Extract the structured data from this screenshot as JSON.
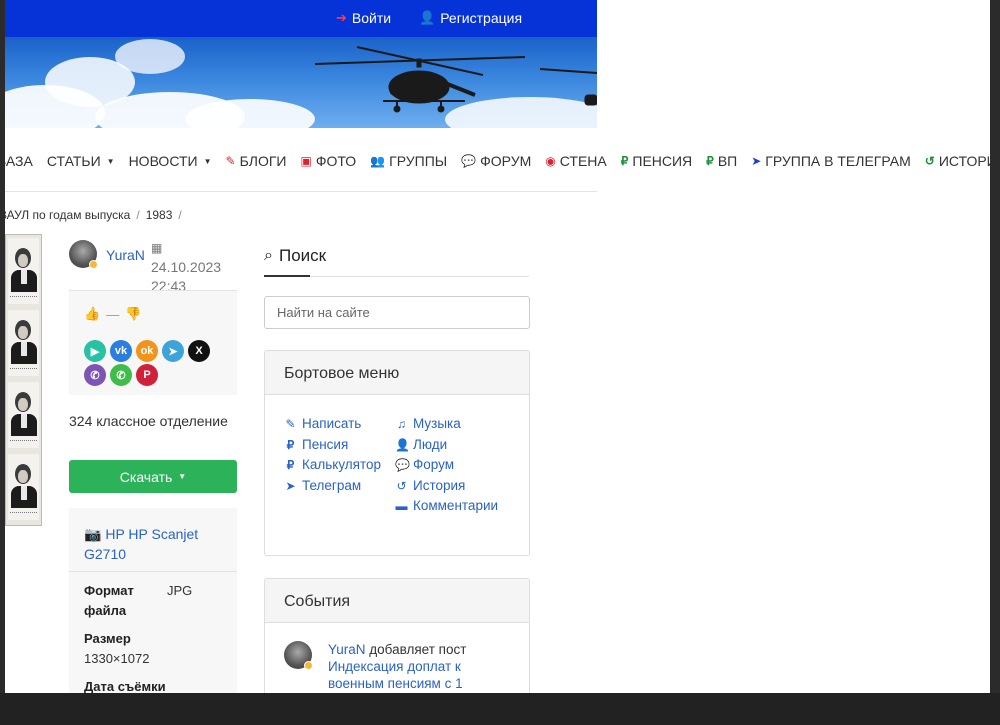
{
  "topbar": {
    "login": "Войти",
    "register": "Регистрация"
  },
  "nav": [
    {
      "label": "БАЗА",
      "icon": "",
      "caret": false,
      "color": "#333333"
    },
    {
      "label": "СТАТЬИ",
      "icon": "",
      "caret": true,
      "color": "#333333"
    },
    {
      "label": "НОВОСТИ",
      "icon": "",
      "caret": true,
      "color": "#333333"
    },
    {
      "label": "БЛОГИ",
      "icon": "pencil-icon",
      "caret": false,
      "color": "#e0202e"
    },
    {
      "label": "ФОТО",
      "icon": "images-icon",
      "caret": false,
      "color": "#e0202e"
    },
    {
      "label": "ГРУППЫ",
      "icon": "users-icon",
      "caret": false,
      "color": "#e0202e"
    },
    {
      "label": "ФОРУМ",
      "icon": "comments-icon",
      "caret": false,
      "color": "#e0202e"
    },
    {
      "label": "СТЕНА",
      "icon": "eye-icon",
      "caret": false,
      "color": "#e0202e"
    },
    {
      "label": "ПЕНСИЯ",
      "icon": "ruble-icon",
      "caret": false,
      "color": "#1f8f3a"
    },
    {
      "label": "ВП",
      "icon": "ruble-icon",
      "caret": false,
      "color": "#1f8f3a"
    },
    {
      "label": "ГРУППА В ТЕЛЕГРАМ",
      "icon": "telegram-icon",
      "caret": false,
      "color": "#1d3fc9"
    },
    {
      "label": "ИСТОРИЯ",
      "icon": "history-icon",
      "caret": false,
      "color": "#1f8f3a"
    }
  ],
  "breadcrumb": {
    "item1": "ВАУЛ по годам выпуска",
    "sep": "/",
    "item2": "1983"
  },
  "post": {
    "author": "YuraN",
    "date": "24.10.2023",
    "time": "22:43",
    "votes": "—",
    "album": "324 классное отделение",
    "download": "Скачать"
  },
  "info": {
    "camera": "HP HP Scanjet G2710",
    "format_label": "Формат файла",
    "format_value": "JPG",
    "size_label": "Размер",
    "size_value": "1330×1072",
    "date_label": "Дата съёмки"
  },
  "search": {
    "title": "Поиск",
    "placeholder": "Найти на сайте"
  },
  "board_menu": {
    "title": "Бортовое меню",
    "left": [
      {
        "label": "Написать",
        "icon": "pencil-icon"
      },
      {
        "label": "Пенсия",
        "icon": "ruble-icon"
      },
      {
        "label": "Калькулятор",
        "icon": "ruble-icon"
      },
      {
        "label": "Телеграм",
        "icon": "telegram-icon"
      }
    ],
    "right": [
      {
        "label": "Музыка",
        "icon": "music-icon"
      },
      {
        "label": "Люди",
        "icon": "user-icon"
      },
      {
        "label": "Форум",
        "icon": "comments-icon"
      },
      {
        "label": "История",
        "icon": "history-icon"
      },
      {
        "label": "Комментарии",
        "icon": "comment-icon"
      }
    ]
  },
  "events": {
    "title": "События",
    "author": "YuraN",
    "action": "добавляет пост",
    "post_line1": "Индексация доплат к",
    "post_line2": "военным пенсиям с 1"
  },
  "colors": {
    "topbar": "#0533d8",
    "link": "#2a62c6",
    "download": "#2cb35a"
  }
}
